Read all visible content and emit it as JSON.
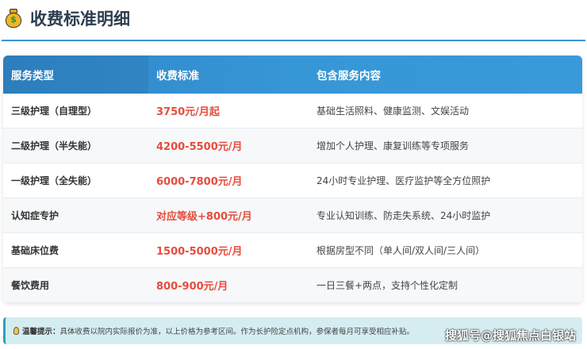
{
  "title": "收费标准明细",
  "table": {
    "headers": [
      "服务类型",
      "收费标准",
      "包含服务内容"
    ],
    "rows": [
      {
        "type": "三级护理（自理型）",
        "price": "3750元/月起",
        "content": "基础生活照料、健康监测、文娱活动"
      },
      {
        "type": "二级护理（半失能）",
        "price": "4200-5500元/月",
        "content": "增加个人护理、康复训练等专项服务"
      },
      {
        "type": "一级护理（全失能）",
        "price": "6000-7800元/月",
        "content": "24小时专业护理、医疗监护等全方位照护"
      },
      {
        "type": "认知症专护",
        "price": "对应等级+800元/月",
        "content": "专业认知训练、防走失系统、24小时监护"
      },
      {
        "type": "基础床位费",
        "price": "1500-5000元/月",
        "content": "根据房型不同（单人间/双人间/三人间）"
      },
      {
        "type": "餐饮费用",
        "price": "800-900元/月",
        "content": "一日三餐+两点，支持个性化定制"
      }
    ]
  },
  "tip": {
    "label": "温馨提示：",
    "text": "具体收费以院内实际报价为准，以上价格为参考区间。作为长护险定点机构，参保者每月可享受相应补贴。"
  },
  "watermark": "搜狐号@搜狐焦点白银站"
}
